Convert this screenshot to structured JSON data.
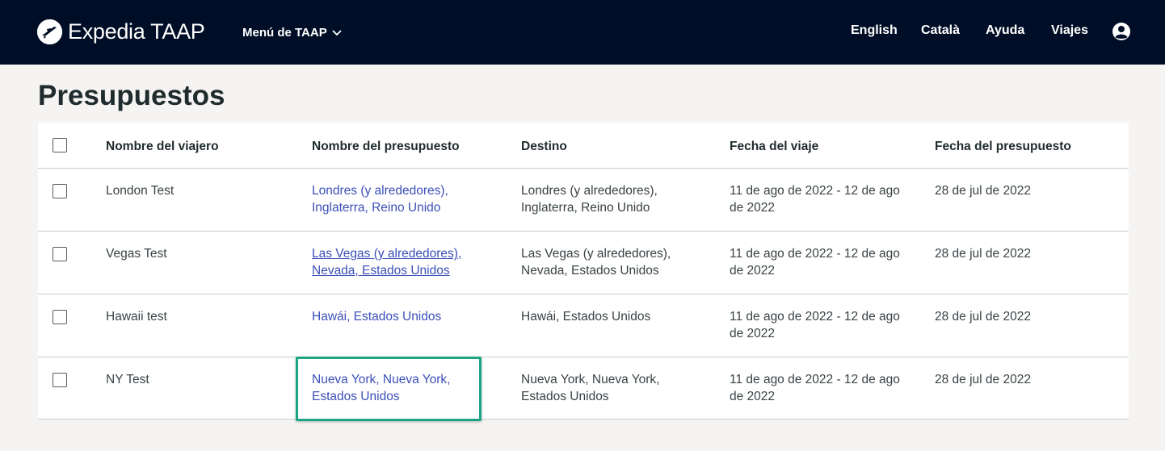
{
  "header": {
    "brand": "Expedia TAAP",
    "menu_label": "Menú de TAAP",
    "nav": [
      "English",
      "Català",
      "Ayuda",
      "Viajes"
    ]
  },
  "page": {
    "title": "Presupuestos"
  },
  "table": {
    "columns": [
      "Nombre del viajero",
      "Nombre del presupuesto",
      "Destino",
      "Fecha del viaje",
      "Fecha del presupuesto"
    ],
    "rows": [
      {
        "traveler": "London Test",
        "quote": "Londres (y alrededores), Inglaterra, Reino Unido",
        "destination": "Londres (y alrededores), Inglaterra, Reino Unido",
        "trip_dates": "11 de ago de 2022 - 12 de ago de 2022",
        "quote_date": "28 de jul de 2022"
      },
      {
        "traveler": "Vegas Test",
        "quote": "Las Vegas (y alrededores), Nevada, Estados Unidos",
        "destination": "Las Vegas (y alrededores), Nevada, Estados Unidos",
        "trip_dates": "11 de ago de 2022 - 12 de ago de 2022",
        "quote_date": "28 de jul de 2022"
      },
      {
        "traveler": "Hawaii test",
        "quote": "Hawái, Estados Unidos",
        "destination": "Hawái, Estados Unidos",
        "trip_dates": "11 de ago de 2022 - 12 de ago de 2022",
        "quote_date": "28 de jul de 2022"
      },
      {
        "traveler": "NY Test",
        "quote": "Nueva York, Nueva York, Estados Unidos",
        "destination": "Nueva York, Nueva York, Estados Unidos",
        "trip_dates": "11 de ago de 2022 - 12 de ago de 2022",
        "quote_date": "28 de jul de 2022"
      }
    ]
  },
  "icons": {
    "logo": "plane-logo-icon",
    "menu_chevron": "chevron-down-icon",
    "account": "account-circle-icon"
  },
  "colors": {
    "header_bg": "#000d26",
    "link": "#3b4fb8",
    "highlight": "#1aa586",
    "page_bg": "#f5f4f2"
  }
}
